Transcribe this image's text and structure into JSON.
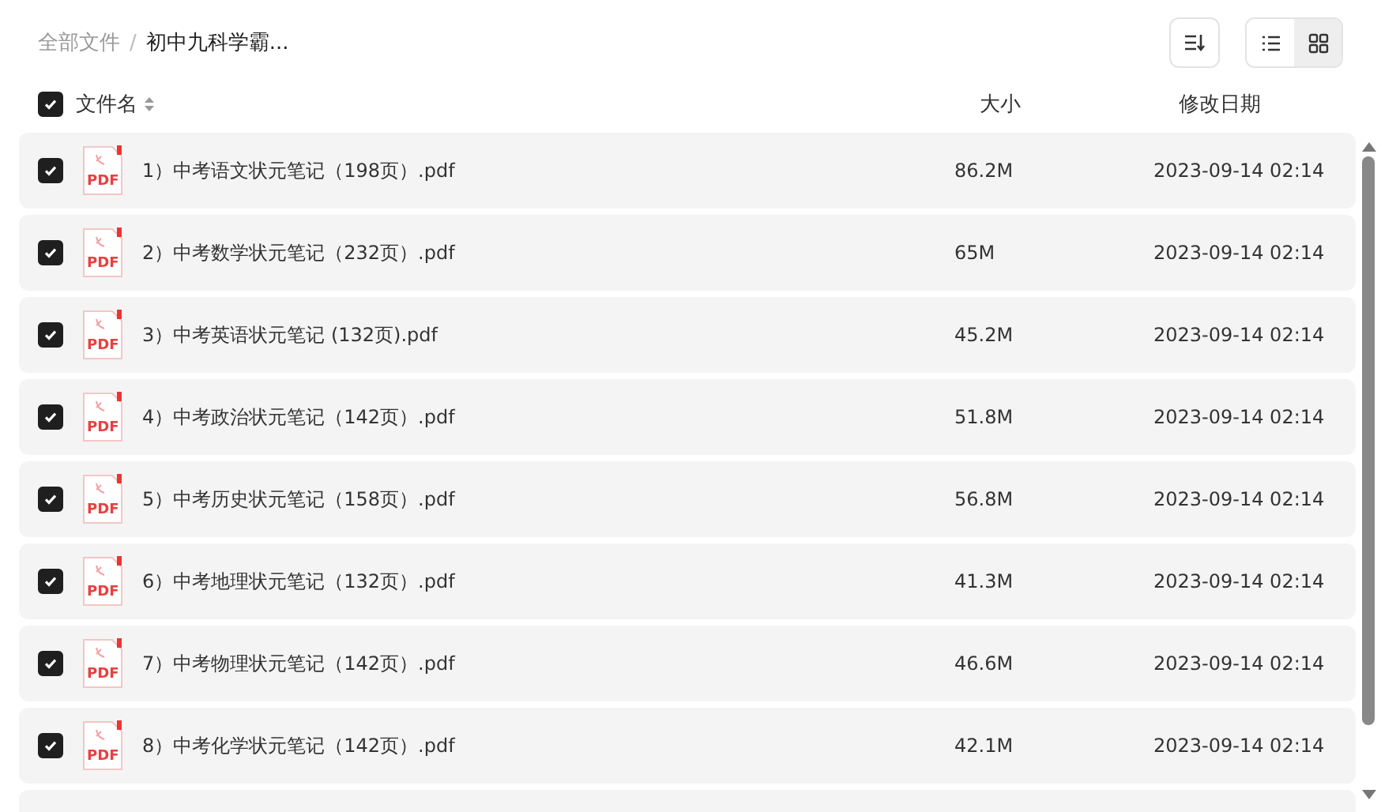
{
  "breadcrumb": [
    {
      "label": "全部文件"
    },
    {
      "label": "初中九科学霸..."
    }
  ],
  "breadcrumb_separator": "/",
  "view_toggle": [
    {
      "kind": "list",
      "selected": true
    },
    {
      "kind": "grid",
      "selected": false
    }
  ],
  "header": {
    "checked": true,
    "name": "文件名",
    "size": "大小",
    "date": "修改日期"
  },
  "files": [
    {
      "checked": true,
      "icon_label": "PDF",
      "name": "1）中考语文状元笔记（198页）.pdf",
      "size": "86.2M",
      "date": "2023-09-14 02:14"
    },
    {
      "checked": true,
      "icon_label": "PDF",
      "name": "2）中考数学状元笔记（232页）.pdf",
      "size": "65M",
      "date": "2023-09-14 02:14"
    },
    {
      "checked": true,
      "icon_label": "PDF",
      "name": "3）中考英语状元笔记 (132页).pdf",
      "size": "45.2M",
      "date": "2023-09-14 02:14"
    },
    {
      "checked": true,
      "icon_label": "PDF",
      "name": "4）中考政治状元笔记（142页）.pdf",
      "size": "51.8M",
      "date": "2023-09-14 02:14"
    },
    {
      "checked": true,
      "icon_label": "PDF",
      "name": "5）中考历史状元笔记（158页）.pdf",
      "size": "56.8M",
      "date": "2023-09-14 02:14"
    },
    {
      "checked": true,
      "icon_label": "PDF",
      "name": "6）中考地理状元笔记（132页）.pdf",
      "size": "41.3M",
      "date": "2023-09-14 02:14"
    },
    {
      "checked": true,
      "icon_label": "PDF",
      "name": "7）中考物理状元笔记（142页）.pdf",
      "size": "46.6M",
      "date": "2023-09-14 02:14"
    },
    {
      "checked": true,
      "icon_label": "PDF",
      "name": "8）中考化学状元笔记（142页）.pdf",
      "size": "42.1M",
      "date": "2023-09-14 02:14"
    }
  ]
}
